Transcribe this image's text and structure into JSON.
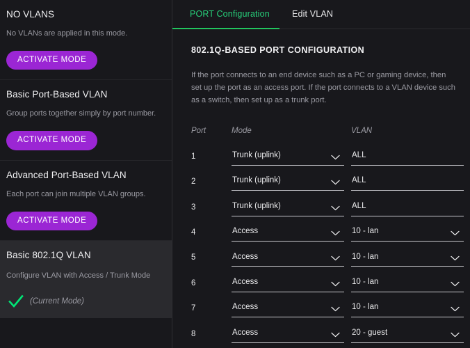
{
  "sidebar": {
    "modes": [
      {
        "title": "NO VLANS",
        "description": "No VLANs are applied in this mode.",
        "button_label": "ACTIVATE MODE",
        "selected": false
      },
      {
        "title": "Basic Port-Based VLAN",
        "description": "Group ports together simply by port number.",
        "button_label": "ACTIVATE MODE",
        "selected": false
      },
      {
        "title": "Advanced Port-Based VLAN",
        "description": "Each port can join multiple VLAN groups.",
        "button_label": "ACTIVATE MODE",
        "selected": false
      },
      {
        "title": "Basic 802.1Q VLAN",
        "description": "Configure VLAN with Access / Trunk Mode",
        "current_mode_label": "(Current Mode)",
        "check_icon": "check-icon",
        "selected": true
      }
    ]
  },
  "tabs": [
    {
      "label": "PORT Configuration",
      "active": true
    },
    {
      "label": "Edit VLAN",
      "active": false
    }
  ],
  "main": {
    "section_title": "802.1Q-BASED PORT CONFIGURATION",
    "section_description": "If the port connects to an end device such as a PC or gaming device, then set up the port as an access port. If the port connects to a VLAN device such as a switch, then set up as a trunk port.",
    "table": {
      "headers": {
        "port": "Port",
        "mode": "Mode",
        "vlan": "VLAN"
      },
      "rows": [
        {
          "port": "1",
          "mode": "Trunk (uplink)",
          "vlan": "ALL",
          "vlan_is_dropdown": false
        },
        {
          "port": "2",
          "mode": "Trunk (uplink)",
          "vlan": "ALL",
          "vlan_is_dropdown": false
        },
        {
          "port": "3",
          "mode": "Trunk (uplink)",
          "vlan": "ALL",
          "vlan_is_dropdown": false
        },
        {
          "port": "4",
          "mode": "Access",
          "vlan": "10 - lan",
          "vlan_is_dropdown": true
        },
        {
          "port": "5",
          "mode": "Access",
          "vlan": "10 - lan",
          "vlan_is_dropdown": true
        },
        {
          "port": "6",
          "mode": "Access",
          "vlan": "10 - lan",
          "vlan_is_dropdown": true
        },
        {
          "port": "7",
          "mode": "Access",
          "vlan": "10 - lan",
          "vlan_is_dropdown": true
        },
        {
          "port": "8",
          "mode": "Access",
          "vlan": "20 - guest",
          "vlan_is_dropdown": true
        }
      ]
    }
  },
  "colors": {
    "background": "#18181c",
    "selected_card": "#2a2a2e",
    "accent_purple": "#9B26D4",
    "accent_green": "#22C55E",
    "check_green": "#00E676",
    "muted_text": "#9b9ba3"
  },
  "icons": {
    "chevron_down": "chevron-down-icon",
    "check": "check-icon"
  }
}
